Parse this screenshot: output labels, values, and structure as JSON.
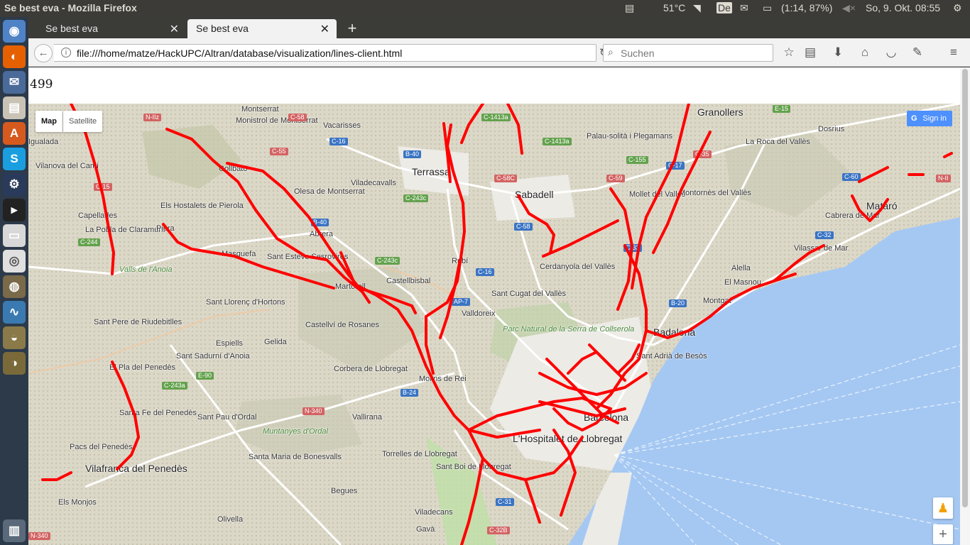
{
  "system": {
    "window_title": "Se best eva - Mozilla Firefox",
    "temperature": "51°C",
    "keyboard": "De",
    "battery": "(1:14, 87%)",
    "datetime": "So, 9. Okt. 08:55"
  },
  "tabs": [
    {
      "label": "Se best eva"
    },
    {
      "label": "Se best eva"
    }
  ],
  "navbar": {
    "url": "file:///home/matze/HackUPC/Altran/database/visualization/lines-client.html",
    "search_placeholder": "Suchen"
  },
  "page": {
    "count": "499"
  },
  "map": {
    "map_button": "Map",
    "satellite_button": "Satellite",
    "sign_in": "Sign in",
    "zoom_in": "+",
    "route_color": "#ff0000",
    "water_color": "#a5c8f3",
    "places": [
      "Montserrat",
      "Monistrol de Montserrat",
      "Vacarisses",
      "Terrassa",
      "Sabadell",
      "Granollers",
      "Palau-solità i Plegamans",
      "Vilanova del Camí",
      "Igualada",
      "Collbató",
      "Olesa de Montserrat",
      "Viladecavalls",
      "Mollet del Vallès",
      "Montornès del Vallès",
      "La Roca del Vallès",
      "Dosrius",
      "Mataró",
      "Cabrera de Mar",
      "Vilassar de Mar",
      "Capellades",
      "La Pobla de Claramunt",
      "Els Hostalets de Pierola",
      "Piera",
      "Abrera",
      "Masquefa",
      "Sant Esteve Sesrovires",
      "Rubí",
      "Cerdanyola del Vallès",
      "Sant Cugat del Vallès",
      "Castellbisbal",
      "Martorell",
      "Valldoreix",
      "Alella",
      "El Masnou",
      "Montgat",
      "Badalona",
      "Sant Adrià de Besòs",
      "Sant Llorenç d'Hortons",
      "Gelida",
      "Castellví de Rosanes",
      "Sant Pere de Riudebitlles",
      "Parc Natural de la Serra de Collserola",
      "Espiells",
      "Sant Sadurní d'Anoia",
      "Corbera de Llobregat",
      "Molins de Rei",
      "Barcelona",
      "El Pla del Penedès",
      "Santa Fe del Penedès",
      "Sant Pau d'Ordal",
      "Vallirana",
      "L'Hospitalet de Llobregat",
      "Pacs del Penedès",
      "Muntanyes d'Ordal",
      "Torrelles de Llobregat",
      "Vilafranca del Penedès",
      "Santa Maria de Bonesvalls",
      "Sant Boi de Llobregat",
      "Begues",
      "Els Monjos",
      "Olivella",
      "Viladecans",
      "Gavà",
      "Valls de l'Anoia"
    ],
    "roads": [
      "N-IIz",
      "C-58",
      "C-16",
      "B-40",
      "C-55",
      "C-1413a",
      "E-15",
      "C-155",
      "C-35",
      "C-60",
      "N-II",
      "C-243c",
      "C-58C",
      "C-59",
      "C-15",
      "C-1413a",
      "C-17",
      "C-244",
      "C-243c",
      "B-40",
      "C-16",
      "C-58",
      "AP-7",
      "C-33",
      "B-20",
      "N-340",
      "C-243a",
      "E-90",
      "B-24",
      "C-31",
      "C-32",
      "C-32B",
      "N-340"
    ]
  }
}
